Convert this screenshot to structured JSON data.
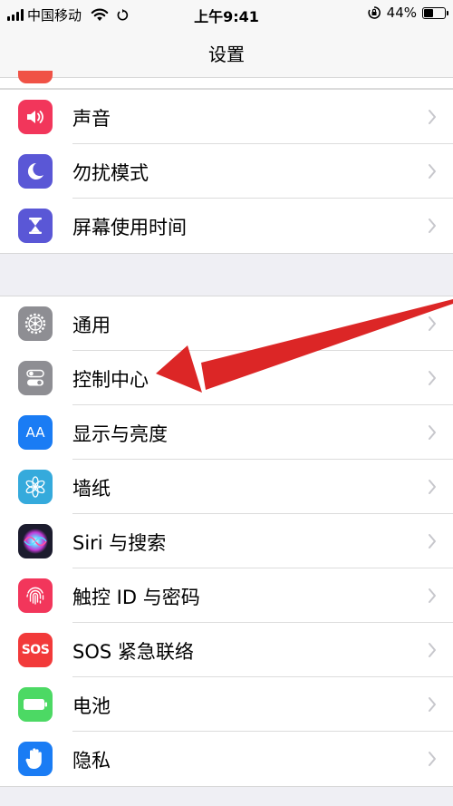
{
  "status": {
    "carrier": "中国移动",
    "time": "上午9:41",
    "battery": "44%",
    "battery_level": 0.44
  },
  "nav": {
    "title": "设置"
  },
  "group1": [
    {
      "label": "声音",
      "icon": "speaker-icon",
      "color": "#f2365b"
    },
    {
      "label": "勿扰模式",
      "icon": "moon-icon",
      "color": "#5a57d6"
    },
    {
      "label": "屏幕使用时间",
      "icon": "hourglass-icon",
      "color": "#5a57d6"
    }
  ],
  "group2": [
    {
      "label": "通用",
      "icon": "gear-icon",
      "color": "#8e8e93"
    },
    {
      "label": "控制中心",
      "icon": "toggles-icon",
      "color": "#8e8e93"
    },
    {
      "label": "显示与亮度",
      "icon": "text-size-icon",
      "color": "#1a7cf4",
      "glyph": "AA"
    },
    {
      "label": "墙纸",
      "icon": "flower-icon",
      "color": "#35aadc"
    },
    {
      "label": "Siri 与搜索",
      "icon": "siri-icon",
      "color": "#1c1c2e"
    },
    {
      "label": "触控 ID 与密码",
      "icon": "fingerprint-icon",
      "color": "#f2365b"
    },
    {
      "label": "SOS 紧急联络",
      "icon": "sos-icon",
      "color": "#f23a3a",
      "glyph": "SOS"
    },
    {
      "label": "电池",
      "icon": "battery-icon",
      "color": "#4cd964"
    },
    {
      "label": "隐私",
      "icon": "hand-icon",
      "color": "#1a7cf4"
    }
  ],
  "colors": {
    "arrow": "#dc2626",
    "chevron": "#c7c7cc"
  }
}
